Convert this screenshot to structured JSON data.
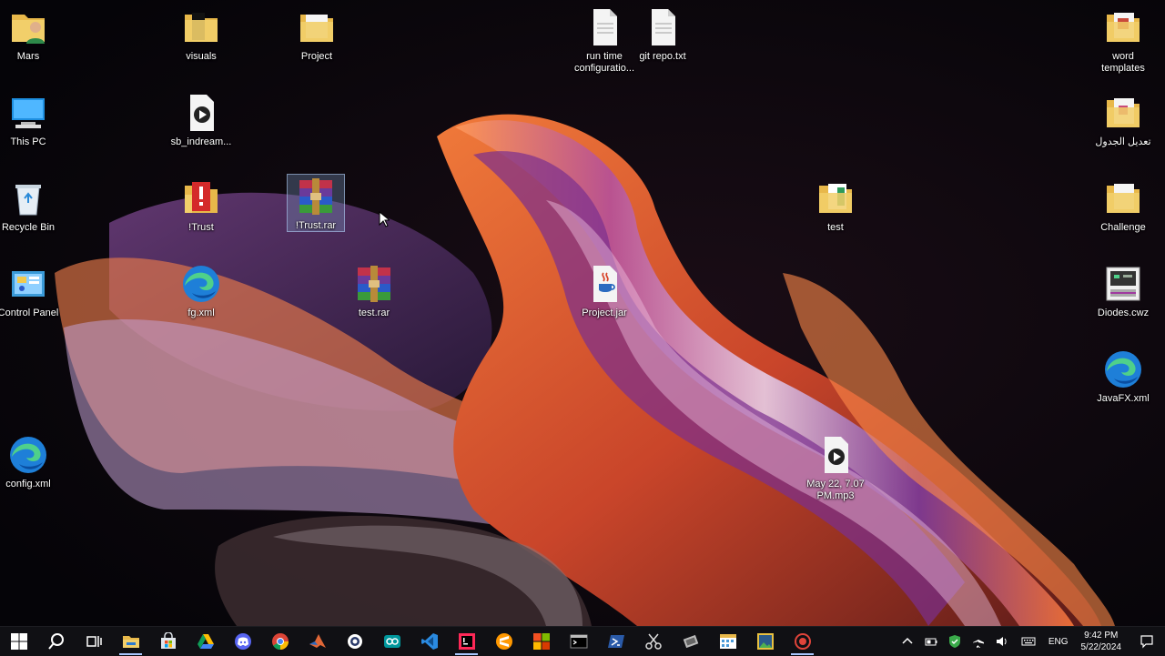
{
  "desktop": {
    "icons": [
      {
        "label": "Mars",
        "icon": "user-folder-icon"
      },
      {
        "label": "visuals",
        "icon": "folder-icon"
      },
      {
        "label": "Project",
        "icon": "folder-icon"
      },
      {
        "label": "run time configuratio...",
        "icon": "text-file-icon"
      },
      {
        "label": "git repo.txt",
        "icon": "text-file-icon"
      },
      {
        "label": "word templates",
        "icon": "folder-icon"
      },
      {
        "label": "This PC",
        "icon": "computer-icon"
      },
      {
        "label": "sb_indream...",
        "icon": "media-file-icon"
      },
      {
        "label": "تعديل الجدول",
        "icon": "folder-icon"
      },
      {
        "label": "Recycle Bin",
        "icon": "recycle-bin-icon"
      },
      {
        "label": "!Trust",
        "icon": "warning-folder-icon"
      },
      {
        "label": "!Trust.rar",
        "icon": "rar-archive-icon"
      },
      {
        "label": "test",
        "icon": "folder-icon"
      },
      {
        "label": "Challenge",
        "icon": "folder-icon"
      },
      {
        "label": "Control Panel",
        "icon": "control-panel-icon"
      },
      {
        "label": "fg.xml",
        "icon": "edge-icon"
      },
      {
        "label": "test.rar",
        "icon": "rar-archive-icon"
      },
      {
        "label": "Project.jar",
        "icon": "java-icon"
      },
      {
        "label": "Diodes.cwz",
        "icon": "cwz-file-icon"
      },
      {
        "label": "JavaFX.xml",
        "icon": "edge-icon"
      },
      {
        "label": "May 22, 7.07 PM.mp3",
        "icon": "media-file-icon"
      },
      {
        "label": "config.xml",
        "icon": "edge-icon"
      }
    ]
  },
  "taskbar": {
    "apps": [
      "windows-start-icon",
      "search-icon",
      "task-view-icon",
      "file-explorer-icon",
      "microsoft-store-icon",
      "google-drive-icon",
      "discord-icon",
      "chrome-icon",
      "matlab-icon",
      "settings-app-icon",
      "arduino-icon",
      "vscode-icon",
      "intellij-icon",
      "sublime-icon",
      "office-icon",
      "terminal-icon",
      "powershell-icon",
      "snipping-tool-icon",
      "tool-icon",
      "calendar-app-icon",
      "image-viewer-icon",
      "recorder-icon"
    ],
    "tray": {
      "language": "ENG",
      "time": "9:42 PM",
      "date": "5/22/2024"
    }
  },
  "colors": {
    "taskbar_bg": "#101014",
    "folder_yellow": "#f2c94c",
    "accent_blue": "#a9c8ff"
  }
}
